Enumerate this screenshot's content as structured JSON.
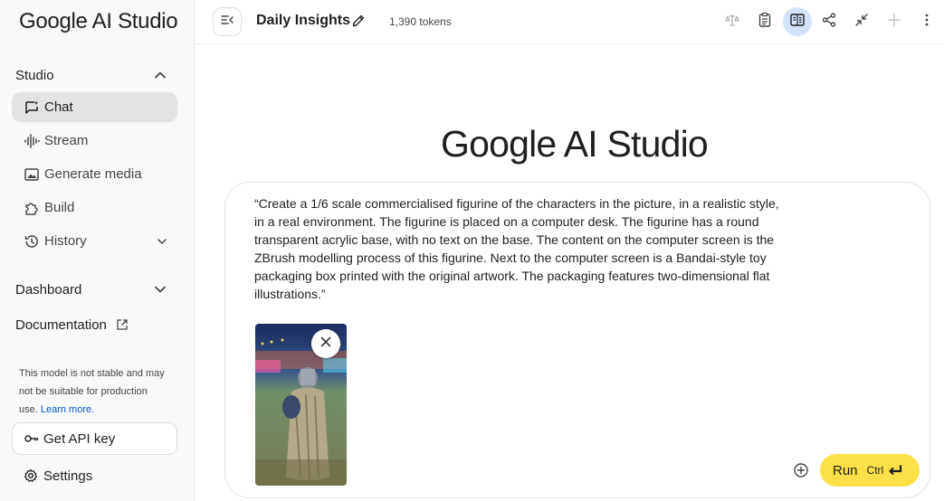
{
  "app": {
    "logo": "Google AI Studio"
  },
  "sidebar": {
    "studio": {
      "label": "Studio"
    },
    "items": [
      {
        "label": "Chat",
        "icon": "chat-icon",
        "active": true
      },
      {
        "label": "Stream",
        "icon": "stream-icon"
      },
      {
        "label": "Generate media",
        "icon": "media-icon"
      },
      {
        "label": "Build",
        "icon": "build-icon"
      },
      {
        "label": "History",
        "icon": "history-icon"
      }
    ],
    "dashboard": {
      "label": "Dashboard"
    },
    "documentation": {
      "label": "Documentation"
    },
    "notice": {
      "text": "This model is not stable and may not be suitable for production use.",
      "link": "Learn more."
    },
    "api_key": {
      "label": "Get API key"
    },
    "settings": {
      "label": "Settings"
    }
  },
  "topbar": {
    "title": "Daily Insights",
    "tokens": "1,390 tokens",
    "icons": [
      "compare-icon",
      "clipboard-icon",
      "book-icon",
      "share-icon",
      "compress-icon",
      "add-icon",
      "more-vert-icon"
    ]
  },
  "main": {
    "logo": "Google AI Studio",
    "prompt": "“Create a 1/6 scale commercialised figurine of the characters in the picture, in a realistic style, in a real environment. The figurine is placed on a computer desk. The figurine has a round transparent acrylic base, with no text on the base. The content on the computer screen is the ZBrush modelling process of this figurine. Next to the computer screen is a Bandai-style toy packaging box printed with the original artwork. The packaging features two-dimensional flat illustrations.”",
    "run": {
      "label": "Run",
      "shortcut": "Ctrl"
    }
  },
  "colors": {
    "accent_blue": "#0b57d0",
    "run_button": "#fde047",
    "active_nav": "#e3e3e3",
    "active_toolbar": "#d3e3fd"
  }
}
